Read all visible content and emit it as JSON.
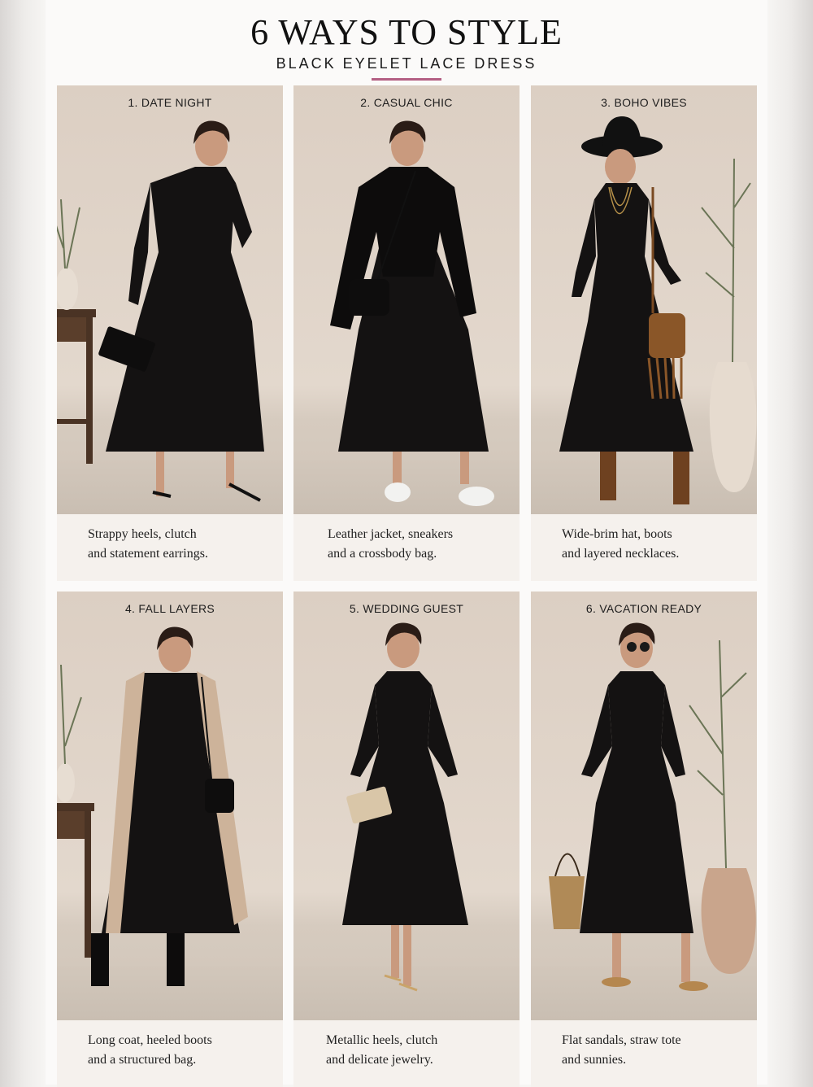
{
  "header": {
    "title": "6 WAYS TO STYLE",
    "subtitle": "BLACK EYELET LACE DRESS",
    "accent_color": "#b35f83"
  },
  "looks": [
    {
      "title": "1. DATE NIGHT",
      "caption_line1": "Strappy heels, clutch",
      "caption_line2": "and statement earrings."
    },
    {
      "title": "2. CASUAL CHIC",
      "caption_line1": "Leather jacket, sneakers",
      "caption_line2": "and a crossbody bag."
    },
    {
      "title": "3. BOHO VIBES",
      "caption_line1": "Wide-brim hat, boots",
      "caption_line2": "and layered necklaces."
    },
    {
      "title": "4. FALL LAYERS",
      "caption_line1": "Long coat, heeled boots",
      "caption_line2": "and a structured bag."
    },
    {
      "title": "5. WEDDING GUEST",
      "caption_line1": "Metallic heels, clutch",
      "caption_line2": "and delicate jewelry."
    },
    {
      "title": "6. VACATION READY",
      "caption_line1": "Flat sandals, straw tote",
      "caption_line2": "and sunnies."
    }
  ]
}
